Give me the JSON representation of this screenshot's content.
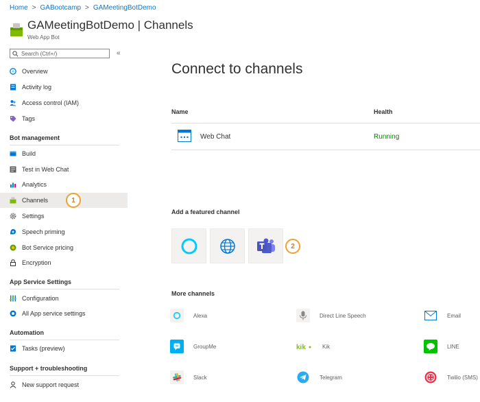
{
  "breadcrumb": {
    "items": [
      "Home",
      "GABootcamp",
      "GAMeetingBotDemo"
    ],
    "separator": ">"
  },
  "header": {
    "title": "GAMeetingBotDemo | Channels",
    "subtitle": "Web App Bot"
  },
  "sidebar": {
    "search_placeholder": "Search (Ctrl+/)",
    "collapse_glyph": "«",
    "top_items": [
      "Overview",
      "Activity log",
      "Access control (IAM)",
      "Tags"
    ],
    "sections": [
      {
        "title": "Bot management",
        "items": [
          "Build",
          "Test in Web Chat",
          "Analytics",
          "Channels",
          "Settings",
          "Speech priming",
          "Bot Service pricing",
          "Encryption"
        ]
      },
      {
        "title": "App Service Settings",
        "items": [
          "Configuration",
          "All App service settings"
        ]
      },
      {
        "title": "Automation",
        "items": [
          "Tasks (preview)"
        ]
      },
      {
        "title": "Support + troubleshooting",
        "items": [
          "New support request"
        ]
      }
    ],
    "selected": "Channels"
  },
  "callouts": [
    "1",
    "2"
  ],
  "main": {
    "title": "Connect to channels",
    "table": {
      "headers": [
        "Name",
        "Health"
      ],
      "rows": [
        {
          "name": "Web Chat",
          "health": "Running"
        }
      ]
    },
    "featured_label": "Add a featured channel",
    "featured": [
      "alexa-icon",
      "globe-icon",
      "teams-icon"
    ],
    "more_label": "More channels",
    "more_channels": [
      "Alexa",
      "Direct Line Speech",
      "Email",
      "GroupMe",
      "Kik",
      "LINE",
      "Slack",
      "Telegram",
      "Twilio (SMS)"
    ]
  },
  "colors": {
    "link": "#0078d4",
    "running": "#107c10",
    "callout": "#f0a030",
    "selected_bg": "#edebe9"
  }
}
